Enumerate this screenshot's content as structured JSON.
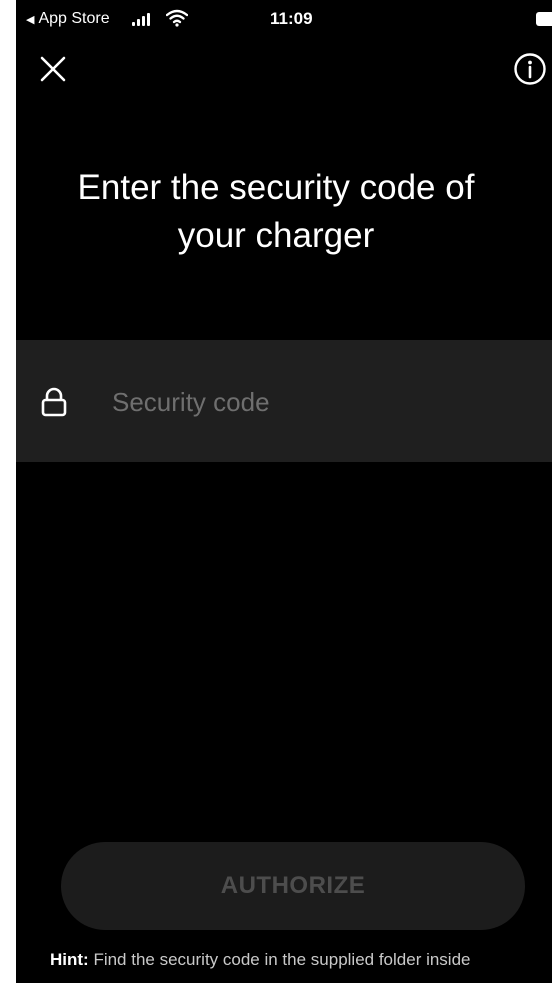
{
  "status_bar": {
    "back_app": "App Store",
    "time": "11:09"
  },
  "header": {
    "close_icon": "close-icon",
    "info_icon": "info-icon"
  },
  "title": "Enter the security code of your charger",
  "input": {
    "icon": "lock-icon",
    "placeholder": "Security code",
    "value": ""
  },
  "authorize_button": {
    "label": "AUTHORIZE"
  },
  "hint": {
    "label": "Hint:",
    "text": " Find the security code in the supplied folder inside"
  },
  "colors": {
    "background": "#000000",
    "input_background": "#1f1f1f",
    "button_background": "#1c1c1c",
    "button_text_disabled": "#4d4d4d"
  }
}
